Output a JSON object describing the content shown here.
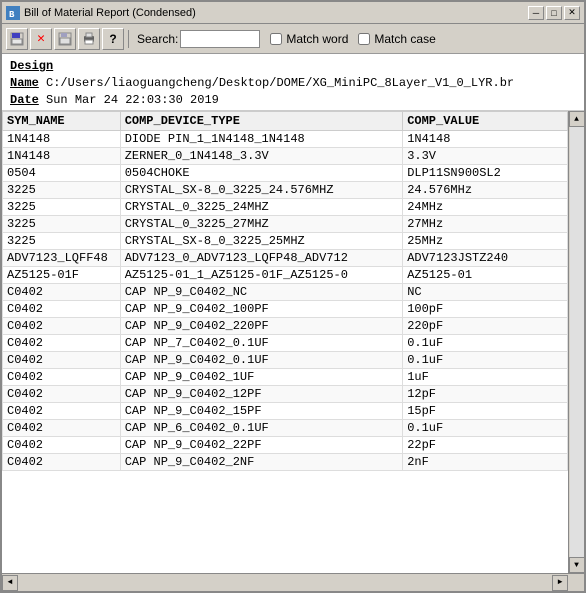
{
  "window": {
    "title": "Bill of Material Report (Condensed)",
    "icon": "BM"
  },
  "title_buttons": {
    "minimize": "─",
    "maximize": "□",
    "close": "✕"
  },
  "toolbar": {
    "tools": [
      {
        "name": "save-icon",
        "symbol": "💾"
      },
      {
        "name": "close-icon",
        "symbol": "✕"
      },
      {
        "name": "disk-icon",
        "symbol": "🖫"
      },
      {
        "name": "print-icon",
        "symbol": "🖨"
      },
      {
        "name": "help-icon",
        "symbol": "?"
      }
    ],
    "search_label": "Search:",
    "search_placeholder": "",
    "match_word_label": "Match word",
    "match_case_label": "Match case"
  },
  "design": {
    "section_label": "Design",
    "name_label": "Name",
    "name_value": "C:/Users/liaoguangcheng/Desktop/DOME/XG_MiniPC_8Layer_V1_0_LYR.br",
    "date_label": "Date",
    "date_value": "Sun Mar 24 22:03:30 2019"
  },
  "table": {
    "columns": [
      "SYM_NAME",
      "COMP_DEVICE_TYPE",
      "COMP_VALUE"
    ],
    "rows": [
      [
        "1N4148",
        "DIODE PIN_1_1N4148_1N4148",
        "1N4148"
      ],
      [
        "1N4148",
        "ZERNER_0_1N4148_3.3V",
        "3.3V"
      ],
      [
        "0504",
        "0504CHOKE",
        "DLP11SN900SL2"
      ],
      [
        "3225",
        "CRYSTAL_SX-8_0_3225_24.576MHZ",
        "24.576MHz"
      ],
      [
        "3225",
        "CRYSTAL_0_3225_24MHZ",
        "24MHz"
      ],
      [
        "3225",
        "CRYSTAL_0_3225_27MHZ",
        "27MHz"
      ],
      [
        "3225",
        "CRYSTAL_SX-8_0_3225_25MHZ",
        "25MHz"
      ],
      [
        "ADV7123_LQFF48",
        "ADV7123_0_ADV7123_LQFP48_ADV712",
        "ADV7123JSTZ240"
      ],
      [
        "AZ5125-01F",
        "AZ5125-01_1_AZ5125-01F_AZ5125-0",
        "AZ5125-01"
      ],
      [
        "C0402",
        "CAP NP_9_C0402_NC",
        "NC"
      ],
      [
        "C0402",
        "CAP NP_9_C0402_100PF",
        "100pF"
      ],
      [
        "C0402",
        "CAP NP_9_C0402_220PF",
        "220pF"
      ],
      [
        "C0402",
        "CAP NP_7_C0402_0.1UF",
        "0.1uF"
      ],
      [
        "C0402",
        "CAP NP_9_C0402_0.1UF",
        "0.1uF"
      ],
      [
        "C0402",
        "CAP NP_9_C0402_1UF",
        "1uF"
      ],
      [
        "C0402",
        "CAP NP_9_C0402_12PF",
        "12pF"
      ],
      [
        "C0402",
        "CAP NP_9_C0402_15PF",
        "15pF"
      ],
      [
        "C0402",
        "CAP NP_6_C0402_0.1UF",
        "0.1uF"
      ],
      [
        "C0402",
        "CAP NP_9_C0402_22PF",
        "22pF"
      ],
      [
        "C0402",
        "CAP NP_9_C0402_2NF",
        "2nF"
      ]
    ]
  }
}
